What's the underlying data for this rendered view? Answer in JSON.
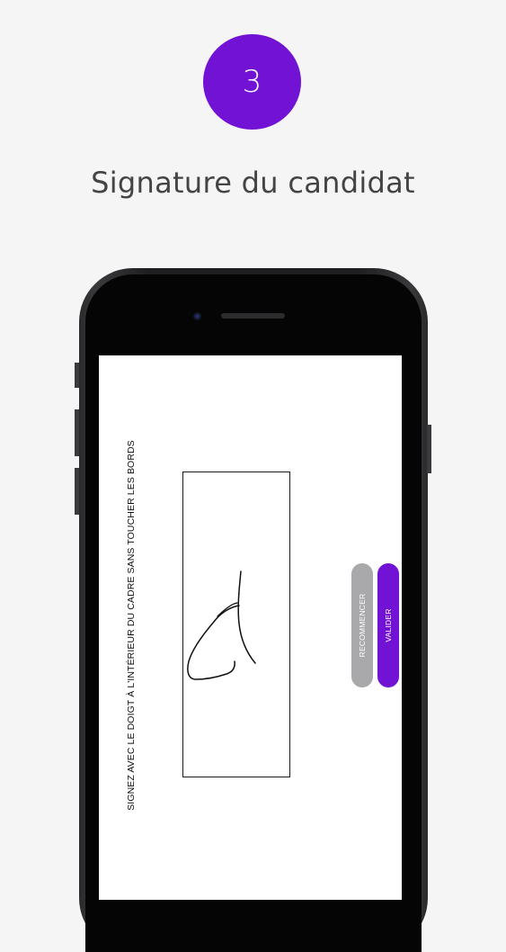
{
  "step": {
    "number": "3",
    "color": "#7112d4"
  },
  "headline": "Signature du candidat",
  "phone": {
    "frame_color": "#1e1e20",
    "screen_color": "#ffffff"
  },
  "app": {
    "instruction": "SIGNEZ AVEC LE DOIGT À L'INTÉRIEUR DU CADRE SANS TOUCHER LES BORDS",
    "restart_label": "RECOMMENCER",
    "validate_label": "VALIDER",
    "restart_color": "#a9a9ab",
    "validate_color": "#7112d4"
  }
}
